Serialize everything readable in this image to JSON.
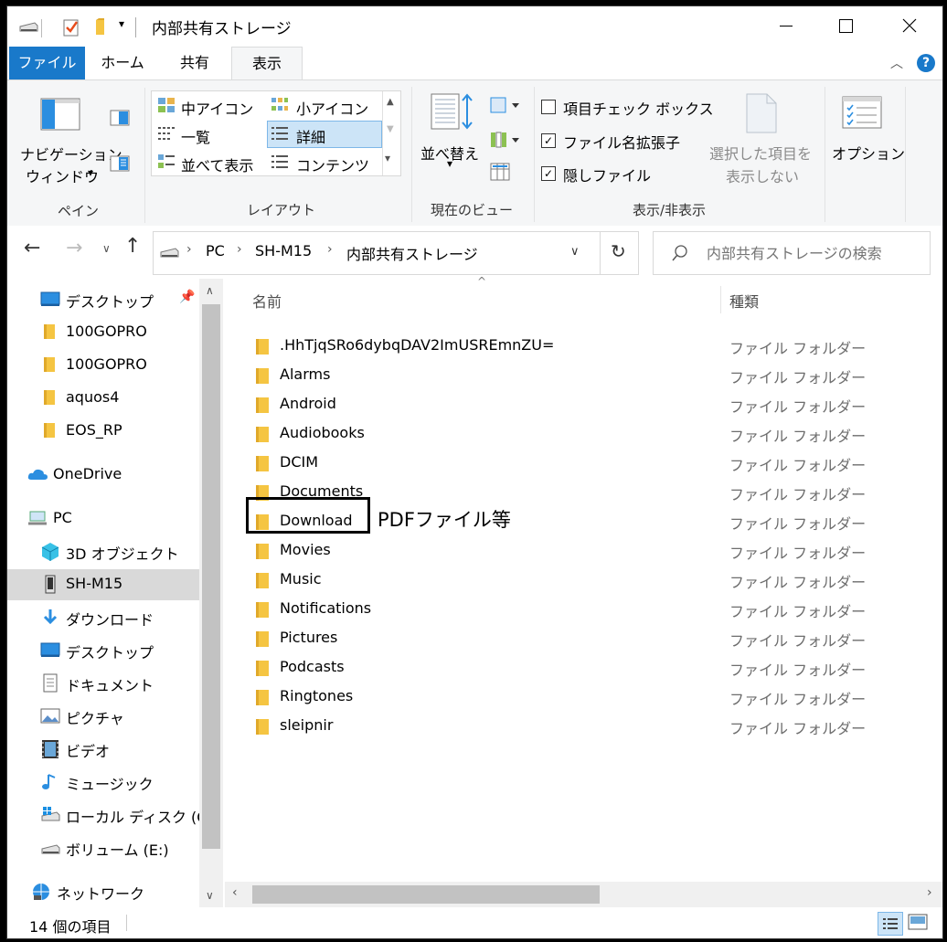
{
  "window": {
    "title": "内部共有ストレージ"
  },
  "ribbon_tabs": [
    "ファイル",
    "ホーム",
    "共有",
    "表示"
  ],
  "ribbon": {
    "pane": {
      "nav_line1": "ナビゲーション",
      "nav_line2": "ウィンドウ",
      "group_label": "ペイン"
    },
    "layout": {
      "items": [
        "中アイコン",
        "小アイコン",
        "一覧",
        "詳細",
        "並べて表示",
        "コンテンツ"
      ],
      "selected": "詳細",
      "group_label": "レイアウト"
    },
    "current_view": {
      "sort_label": "並べ替え",
      "group_label": "現在のビュー"
    },
    "show_hide": {
      "checkboxes": [
        {
          "label": "項目チェック ボックス",
          "checked": false
        },
        {
          "label": "ファイル名拡張子",
          "checked": true
        },
        {
          "label": "隠しファイル",
          "checked": true
        }
      ],
      "hide_selected_line1": "選択した項目を",
      "hide_selected_line2": "表示しない",
      "group_label": "表示/非表示"
    },
    "options_label": "オプション"
  },
  "address": {
    "crumbs": [
      "PC",
      "SH-M15",
      "内部共有ストレージ"
    ]
  },
  "search": {
    "placeholder": "内部共有ストレージの検索"
  },
  "nav_pane": {
    "items": [
      {
        "label": "デスクトップ",
        "icon": "desktop-icon"
      },
      {
        "label": "100GOPRO",
        "icon": "folder-icon"
      },
      {
        "label": "100GOPRO",
        "icon": "folder-icon"
      },
      {
        "label": "aquos4",
        "icon": "folder-icon"
      },
      {
        "label": "EOS_RP",
        "icon": "folder-icon"
      },
      {
        "label": "OneDrive",
        "icon": "cloud-icon"
      },
      {
        "label": "PC",
        "icon": "pc-icon"
      },
      {
        "label": "3D オブジェクト",
        "icon": "3d-objects-icon"
      },
      {
        "label": "SH-M15",
        "icon": "phone-icon"
      },
      {
        "label": "ダウンロード",
        "icon": "download-icon"
      },
      {
        "label": "デスクトップ",
        "icon": "desktop-icon"
      },
      {
        "label": "ドキュメント",
        "icon": "document-icon"
      },
      {
        "label": "ピクチャ",
        "icon": "pictures-icon"
      },
      {
        "label": "ビデオ",
        "icon": "video-icon"
      },
      {
        "label": "ミュージック",
        "icon": "music-icon"
      },
      {
        "label": "ローカル ディスク (C",
        "icon": "local-disk-icon"
      },
      {
        "label": "ボリューム (E:)",
        "icon": "drive-icon"
      },
      {
        "label": "ネットワーク",
        "icon": "network-icon"
      }
    ],
    "selected": "SH-M15"
  },
  "list": {
    "columns": [
      "名前",
      "種類"
    ],
    "rows": [
      {
        "name": ".HhTjqSRo6dybqDAV2ImUSREmnZU=",
        "type": "ファイル フォルダー"
      },
      {
        "name": "Alarms",
        "type": "ファイル フォルダー"
      },
      {
        "name": "Android",
        "type": "ファイル フォルダー"
      },
      {
        "name": "Audiobooks",
        "type": "ファイル フォルダー"
      },
      {
        "name": "DCIM",
        "type": "ファイル フォルダー"
      },
      {
        "name": "Documents",
        "type": "ファイル フォルダー"
      },
      {
        "name": "Download",
        "type": "ファイル フォルダー"
      },
      {
        "name": "Movies",
        "type": "ファイル フォルダー"
      },
      {
        "name": "Music",
        "type": "ファイル フォルダー"
      },
      {
        "name": "Notifications",
        "type": "ファイル フォルダー"
      },
      {
        "name": "Pictures",
        "type": "ファイル フォルダー"
      },
      {
        "name": "Podcasts",
        "type": "ファイル フォルダー"
      },
      {
        "name": "Ringtones",
        "type": "ファイル フォルダー"
      },
      {
        "name": "sleipnir",
        "type": "ファイル フォルダー"
      }
    ],
    "highlighted": "Download"
  },
  "annotation": {
    "text": "PDFファイル等"
  },
  "status": {
    "count_text": "14 個の項目"
  },
  "colors": {
    "accent": "#1979ca",
    "folder": "#f5c542",
    "selected_nav": "#d9d9d9",
    "annotation_box": "#000000"
  }
}
